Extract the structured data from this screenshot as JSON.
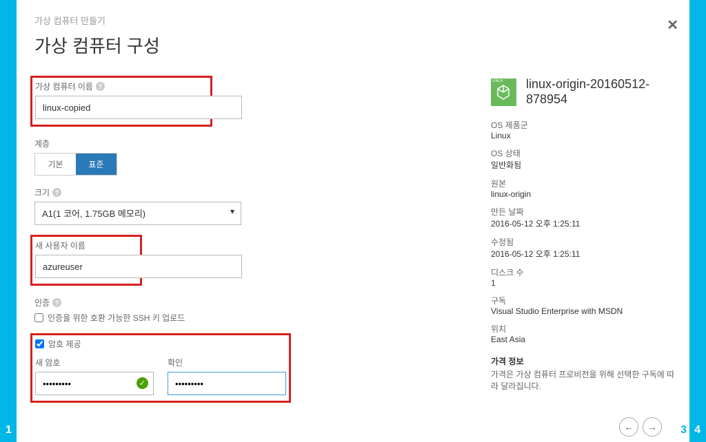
{
  "breadcrumb": "가상 컴퓨터 만들기",
  "page_title": "가상 컴퓨터 구성",
  "form": {
    "vm_name_label": "가상 컴퓨터 이름",
    "vm_name_value": "linux-copied",
    "tier_label": "계층",
    "tier_basic": "기본",
    "tier_standard": "표준",
    "size_label": "크기",
    "size_value": "A1(1 코어, 1.75GB 메모리)",
    "username_label": "새 사용자 이름",
    "username_value": "azureuser",
    "auth_label": "인증",
    "ssh_checkbox_label": "인증을 위한 호환 가능한 SSH 키 업로드",
    "password_checkbox_label": "암호 제공",
    "new_password_label": "새 암호",
    "new_password_value": "•••••••••",
    "confirm_label": "확인",
    "confirm_value": "•••••••••"
  },
  "info": {
    "image_name": "linux-origin-20160512-878954",
    "os_family_label": "OS 제품군",
    "os_family_value": "Linux",
    "os_state_label": "OS 상태",
    "os_state_value": "일반화됨",
    "source_label": "원본",
    "source_value": "linux-origin",
    "created_label": "만든 날짜",
    "created_value": "2016-05-12 오후 1:25:11",
    "modified_label": "수정됨",
    "modified_value": "2016-05-12 오후 1:25:11",
    "disk_count_label": "디스크 수",
    "disk_count_value": "1",
    "subscription_label": "구독",
    "subscription_value": "Visual Studio Enterprise with MSDN",
    "location_label": "위치",
    "location_value": "East Asia",
    "pricing_label": "가격 정보",
    "pricing_desc": "가격은 가상 컴퓨터 프로비전을 위해 선택한 구독에 따라 달라집니다."
  },
  "steps": {
    "s1": "1",
    "s3": "3",
    "s4": "4"
  }
}
